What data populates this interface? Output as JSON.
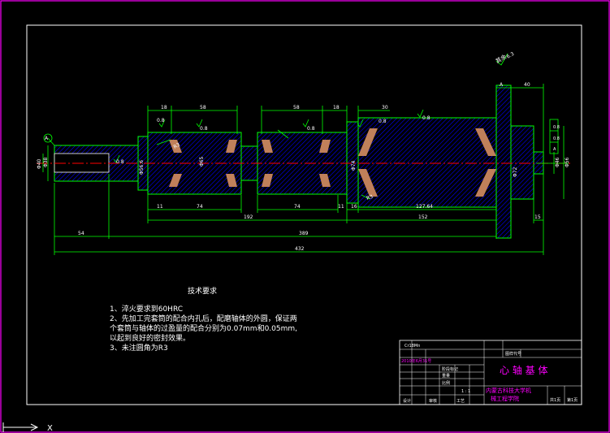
{
  "drawing": {
    "title": "心 轴 基 体",
    "tolerance_label": "其余",
    "roughness": "6.3",
    "datum_left": "A",
    "datum_right": "A",
    "dims_top": [
      "18",
      "58",
      "58",
      "18",
      "30",
      "40"
    ],
    "roughness_marks": [
      "0.8",
      "0.8",
      "0.8",
      "0.8",
      "0.8",
      "0.8"
    ],
    "dims_bottom": [
      "11",
      "74",
      "74",
      "11",
      "16",
      "127.64",
      "15"
    ],
    "dims_long": [
      "192",
      "152",
      "54",
      "389",
      "432"
    ],
    "left_dia": [
      "Φ40",
      "Φ38"
    ],
    "right_dia": [
      "Φ46",
      "Φ56"
    ],
    "mid_dia": [
      "Φ56.6",
      "Φ65",
      "Φ74"
    ],
    "chamfer": [
      "R3",
      "R3"
    ],
    "small_dims": [
      "0.8",
      "Φ72",
      "0.8",
      "0.8"
    ],
    "ucs_label": "X"
  },
  "notes": {
    "title": "技术要求",
    "items": [
      "1、淬火要求到60HRC",
      "2、先加工完套筒的配合内孔后，配磨轴体的外圆，保证两",
      "个套筒与轴体的过盈量的配合分别为0.07mm和0.05mm,",
      "以起到良好的密封效果。",
      "3、未注圆角为R3"
    ]
  },
  "title_block": {
    "material": "Cr18Mn",
    "name": "心 轴 基 体",
    "school": "内蒙古科技大学机",
    "dept": "械工程学院",
    "scale": "1 : 1",
    "sheet_total": "共1页",
    "sheet_no": "第1页",
    "date": "2010年6月31号",
    "row_labels": [
      "标记",
      "处数",
      "分区",
      "更改文件号",
      "签名",
      "日期"
    ],
    "designer": "设计",
    "approve": "审核",
    "craft": "工艺",
    "stage": "阶段标记",
    "weight": "重量",
    "ratio": "比例",
    "code": "图样代号"
  },
  "colors": {
    "frame": "#ffffff",
    "outline": "#00ff00",
    "hatch": "#0000ff",
    "center": "#ff0000",
    "dim": "#00ff00",
    "text": "#ffffff",
    "sleeve": "#c0805a",
    "border": "#ff00ff"
  }
}
